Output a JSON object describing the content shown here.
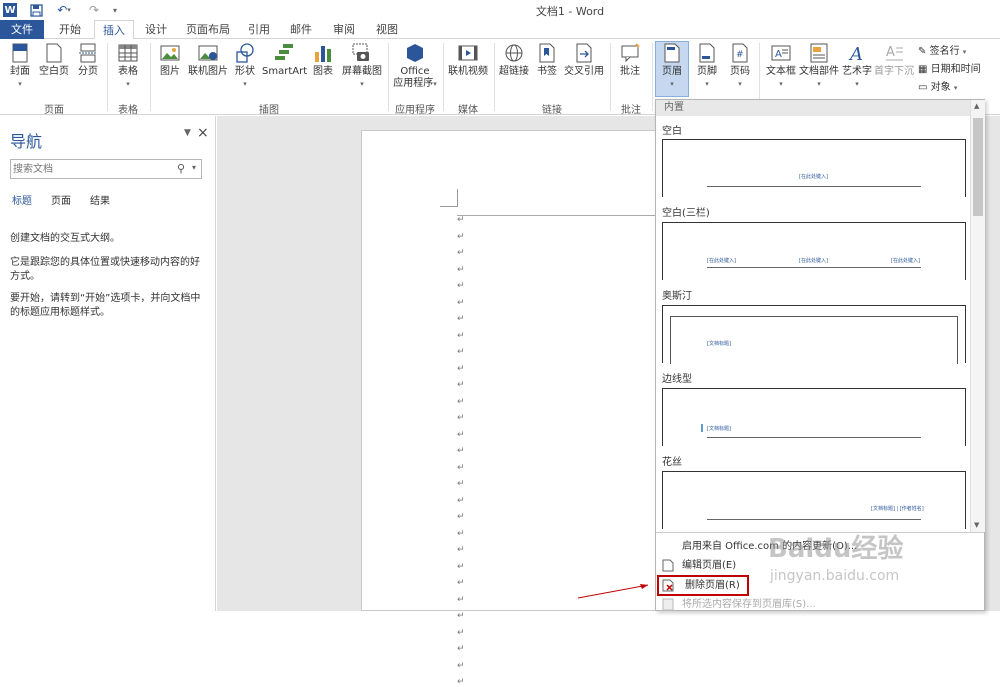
{
  "window": {
    "title": "文档1 - Word"
  },
  "tabs": [
    {
      "label": "文件"
    },
    {
      "label": "开始"
    },
    {
      "label": "插入"
    },
    {
      "label": "设计"
    },
    {
      "label": "页面布局"
    },
    {
      "label": "引用"
    },
    {
      "label": "邮件"
    },
    {
      "label": "审阅"
    },
    {
      "label": "视图"
    }
  ],
  "ribbon": {
    "buttons": {
      "cover": "封面",
      "blank": "空白页",
      "pagebreak": "分页",
      "table": "表格",
      "picture": "图片",
      "online_picture": "联机图片",
      "shapes": "形状",
      "smartart": "SmartArt",
      "chart": "图表",
      "screenshot": "屏幕截图",
      "office_apps_1": "Office",
      "office_apps_2": "应用程序",
      "online_video": "联机视频",
      "hyperlink": "超链接",
      "bookmark": "书签",
      "crossref": "交叉引用",
      "comment": "批注",
      "header": "页眉",
      "footer": "页脚",
      "page_number": "页码",
      "textbox": "文本框",
      "quickparts": "文档部件",
      "wordart": "艺术字",
      "dropcap": "首字下沉",
      "signature": "签名行",
      "datetime": "日期和时间",
      "object": "对象"
    },
    "groups": {
      "pages": "页面",
      "tables": "表格",
      "illustrations": "插图",
      "apps": "应用程序",
      "media": "媒体",
      "links": "链接",
      "comments": "批注"
    }
  },
  "nav": {
    "title": "导航",
    "search_placeholder": "搜索文档",
    "tabs": [
      "标题",
      "页面",
      "结果"
    ],
    "text1": "创建文档的交互式大纲。",
    "text2": "它是跟踪您的具体位置或快速移动内容的好方式。",
    "text3": "要开始，请转到“开始”选项卡，并向文档中的标题应用标题样式。"
  },
  "document": {
    "para_mark": "↵"
  },
  "gallery": {
    "header": "内置",
    "items": [
      {
        "label": "空白"
      },
      {
        "label": "空白(三栏)"
      },
      {
        "label": "奥斯汀"
      },
      {
        "label": "边线型"
      },
      {
        "label": "花丝"
      }
    ],
    "thumb_text": {
      "type_here": "[在此处键入]",
      "doc_title": "[文档标题]",
      "doc_title_austin": "[文档标题]",
      "filigree": "[文档标题] | [作者姓名]"
    },
    "menu": {
      "office_com": "启用来自 Office.com 的内容更新(O)...",
      "edit_header": "编辑页眉(E)",
      "remove_header": "删除页眉(R)",
      "save_selection": "将所选内容保存到页眉库(S)..."
    }
  },
  "watermark": {
    "brand": "Baidu经验",
    "url": "jingyan.baidu.com"
  },
  "colors": {
    "accent": "#2b579a",
    "highlight": "#c00000"
  }
}
